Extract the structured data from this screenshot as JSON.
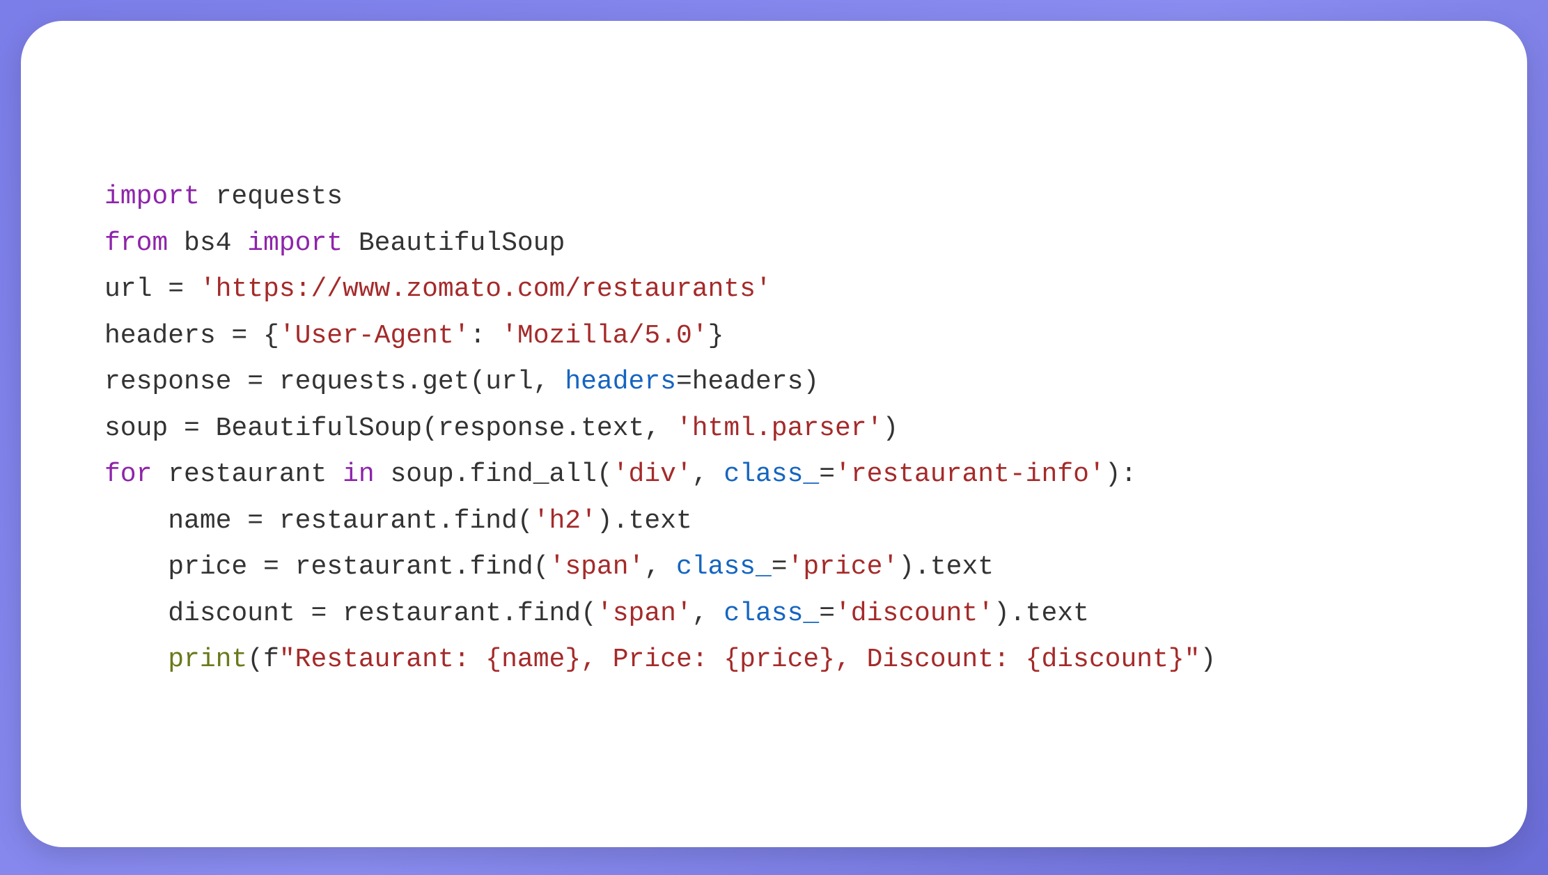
{
  "code": {
    "l1_import": "import",
    "l1_requests": " requests",
    "l2_from": "from",
    "l2_bs4": " bs4 ",
    "l2_import": "import",
    "l2_beautifulsoup": " BeautifulSoup",
    "l3_url": "url = ",
    "l3_str": "'https://www.zomato.com/restaurants'",
    "l4_headers": "headers = {",
    "l4_str1": "'User-Agent'",
    "l4_colon": ": ",
    "l4_str2": "'Mozilla/5.0'",
    "l4_close": "}",
    "l5_resp": "response = requests.get(url, ",
    "l5_param": "headers",
    "l5_end": "=headers)",
    "l6_soup": "soup = BeautifulSoup(response.text, ",
    "l6_str": "'html.parser'",
    "l6_close": ")",
    "l7_for": "for",
    "l7_mid": " restaurant ",
    "l7_in": "in",
    "l7_call": " soup.find_all(",
    "l7_str1": "'div'",
    "l7_comma": ", ",
    "l7_param": "class_",
    "l7_eq": "=",
    "l7_str2": "'restaurant-info'",
    "l7_close": "):",
    "l8_indent": "    name = restaurant.find(",
    "l8_str": "'h2'",
    "l8_end": ").text",
    "l9_indent": "    price = restaurant.find(",
    "l9_str1": "'span'",
    "l9_comma": ", ",
    "l9_param": "class_",
    "l9_eq": "=",
    "l9_str2": "'price'",
    "l9_end": ").text",
    "l10_indent": "    discount = restaurant.find(",
    "l10_str1": "'span'",
    "l10_comma": ", ",
    "l10_param": "class_",
    "l10_eq": "=",
    "l10_str2": "'discount'",
    "l10_end": ").text",
    "l11_indent": "    ",
    "l11_print": "print",
    "l11_open": "(f",
    "l11_str": "\"Restaurant: {name}, Price: {price}, Discount: {discount}\"",
    "l11_close": ")"
  }
}
